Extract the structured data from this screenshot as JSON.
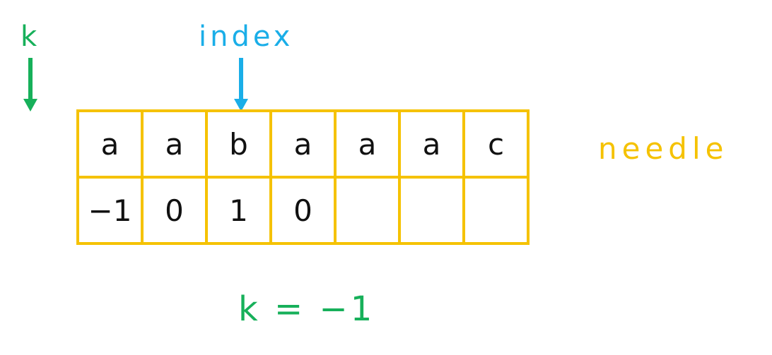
{
  "labels": {
    "k": "k",
    "index": "index",
    "needle": "needle",
    "k_equation": "k = −1"
  },
  "grid": {
    "chars": [
      "a",
      "a",
      "b",
      "a",
      "a",
      "a",
      "c"
    ],
    "next": [
      "−1",
      "0",
      "1",
      "0",
      "",
      "",
      ""
    ]
  },
  "colors": {
    "k_green": "#17b05a",
    "index_blue": "#1aaee8",
    "needle_yellow": "#f5c200",
    "cell_text": "#111111"
  },
  "pointers": {
    "k_column": -1,
    "index_column": 2
  }
}
